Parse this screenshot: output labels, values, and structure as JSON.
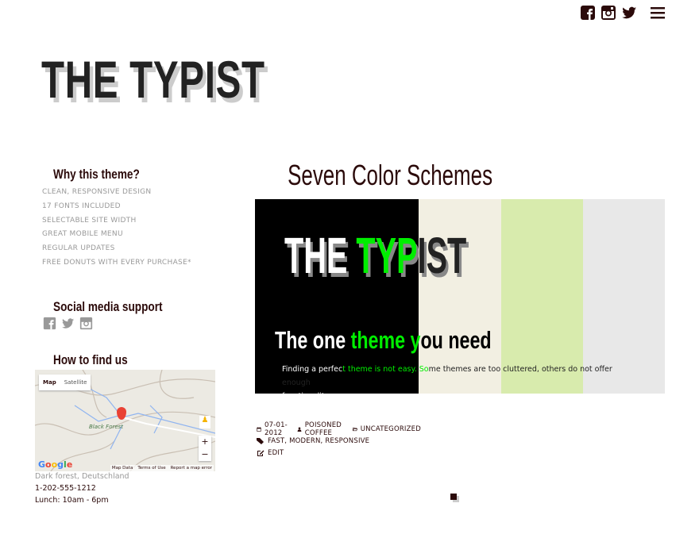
{
  "header": {
    "logo": "THE TYPIST",
    "icons": [
      "facebook-icon",
      "instagram-icon",
      "twitter-icon",
      "menu-icon"
    ]
  },
  "sidebar": {
    "why": {
      "title": "Why this theme?",
      "items": [
        "CLEAN, RESPONSIVE DESIGN",
        "17 FONTS INCLUDED",
        "SELECTABLE SITE WIDTH",
        "GREAT MOBILE MENU",
        "REGULAR UPDATES",
        "FREE DONUTS WITH EVERY PURCHASE*"
      ]
    },
    "social": {
      "title": "Social media support"
    },
    "find": {
      "title": "How to find us",
      "map": {
        "tab_map": "Map",
        "tab_satellite": "Satellite",
        "place": "Black Forest",
        "zoom_in": "+",
        "zoom_out": "−",
        "google": "Google",
        "map_data": "Map Data",
        "terms": "Terms of Use",
        "report": "Report a map error"
      },
      "address": "Dark forest, Deutschland",
      "phone": "1-202-555-1212",
      "hours": "Lunch: 10am - 6pm"
    }
  },
  "post": {
    "title": "Seven Color Schemes",
    "hero": {
      "logo_a": "THE",
      "logo_b": " TYP",
      "logo_c": "IST",
      "sub_a": "The one",
      "sub_b": " theme y",
      "sub_c": "ou need",
      "text_a": "Finding a perfec",
      "text_b": "t theme is not easy. So",
      "text_c": "me themes are too cluttered, others do not offer enough",
      "text_d": "functionality.",
      "colors": [
        "#000000",
        "#f2efe2",
        "#d8ebad",
        "#e8e8e8"
      ],
      "accent": "#00ee00"
    },
    "date": "07-01-2012",
    "author": "POISONED COFFEE",
    "category": "UNCATEGORIZED",
    "tags": "FAST, MODERN, RESPONSIVE",
    "edit": "EDIT"
  }
}
